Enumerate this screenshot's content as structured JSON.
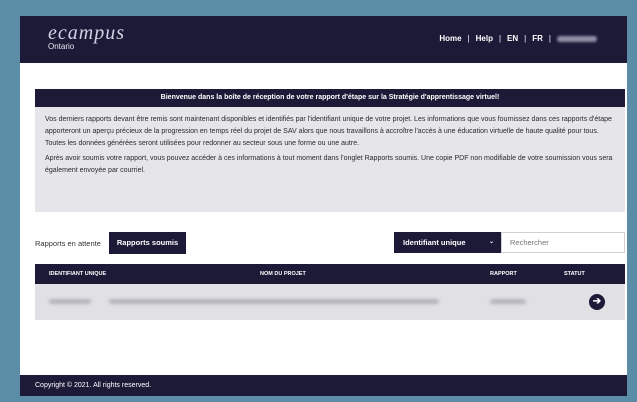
{
  "header": {
    "logo": {
      "main": "ecampus",
      "sub": "Ontario"
    },
    "nav": [
      {
        "label": "Home"
      },
      {
        "label": "Help"
      },
      {
        "label": "EN"
      },
      {
        "label": "FR"
      }
    ],
    "separator": "|"
  },
  "banner": {
    "title": "Bienvenue dans la boîte de réception de votre rapport d'étape sur la Stratégie d'apprentissage virtuel!"
  },
  "info": {
    "paragraph1": "Vos derniers rapports devant être remis sont maintenant disponibles et identifiés par l'identifiant unique de votre projet. Les informations que vous fournissez dans ces rapports d'étape apporteront un aperçu précieux de la progression en temps réel du projet de SAV alors que nous travaillons à accroître l'accès à une éducation virtuelle de haute qualité pour tous. Toutes les données générées seront utilisées pour redonner au secteur sous une forme ou une autre.",
    "paragraph2": "Après avoir soumis votre rapport, vous pouvez accéder à ces informations à tout moment dans l'onglet Rapports soumis. Une copie PDF non modifiable de votre soumission vous sera également envoyée par courriel."
  },
  "tabs": {
    "pending": "Rapports en attente",
    "submitted": "Rapports soumis"
  },
  "filter": {
    "selected": "Identifiant unique",
    "chevron_icon": "chevron-down-icon"
  },
  "search": {
    "placeholder": "Rechercher"
  },
  "table": {
    "columns": [
      "IDENTIFIANT UNIQUE",
      "NOM DU PROJET",
      "RAPPORT",
      "STATUT"
    ],
    "rows": [
      {
        "status_icon": "arrow-right-circle-icon"
      }
    ]
  },
  "footer": {
    "copyright": "Copyright © 2021. All rights reserved."
  },
  "colors": {
    "primary": "#1d1a38",
    "background": "#5b8ea6",
    "panel": "#e6e6ea"
  }
}
